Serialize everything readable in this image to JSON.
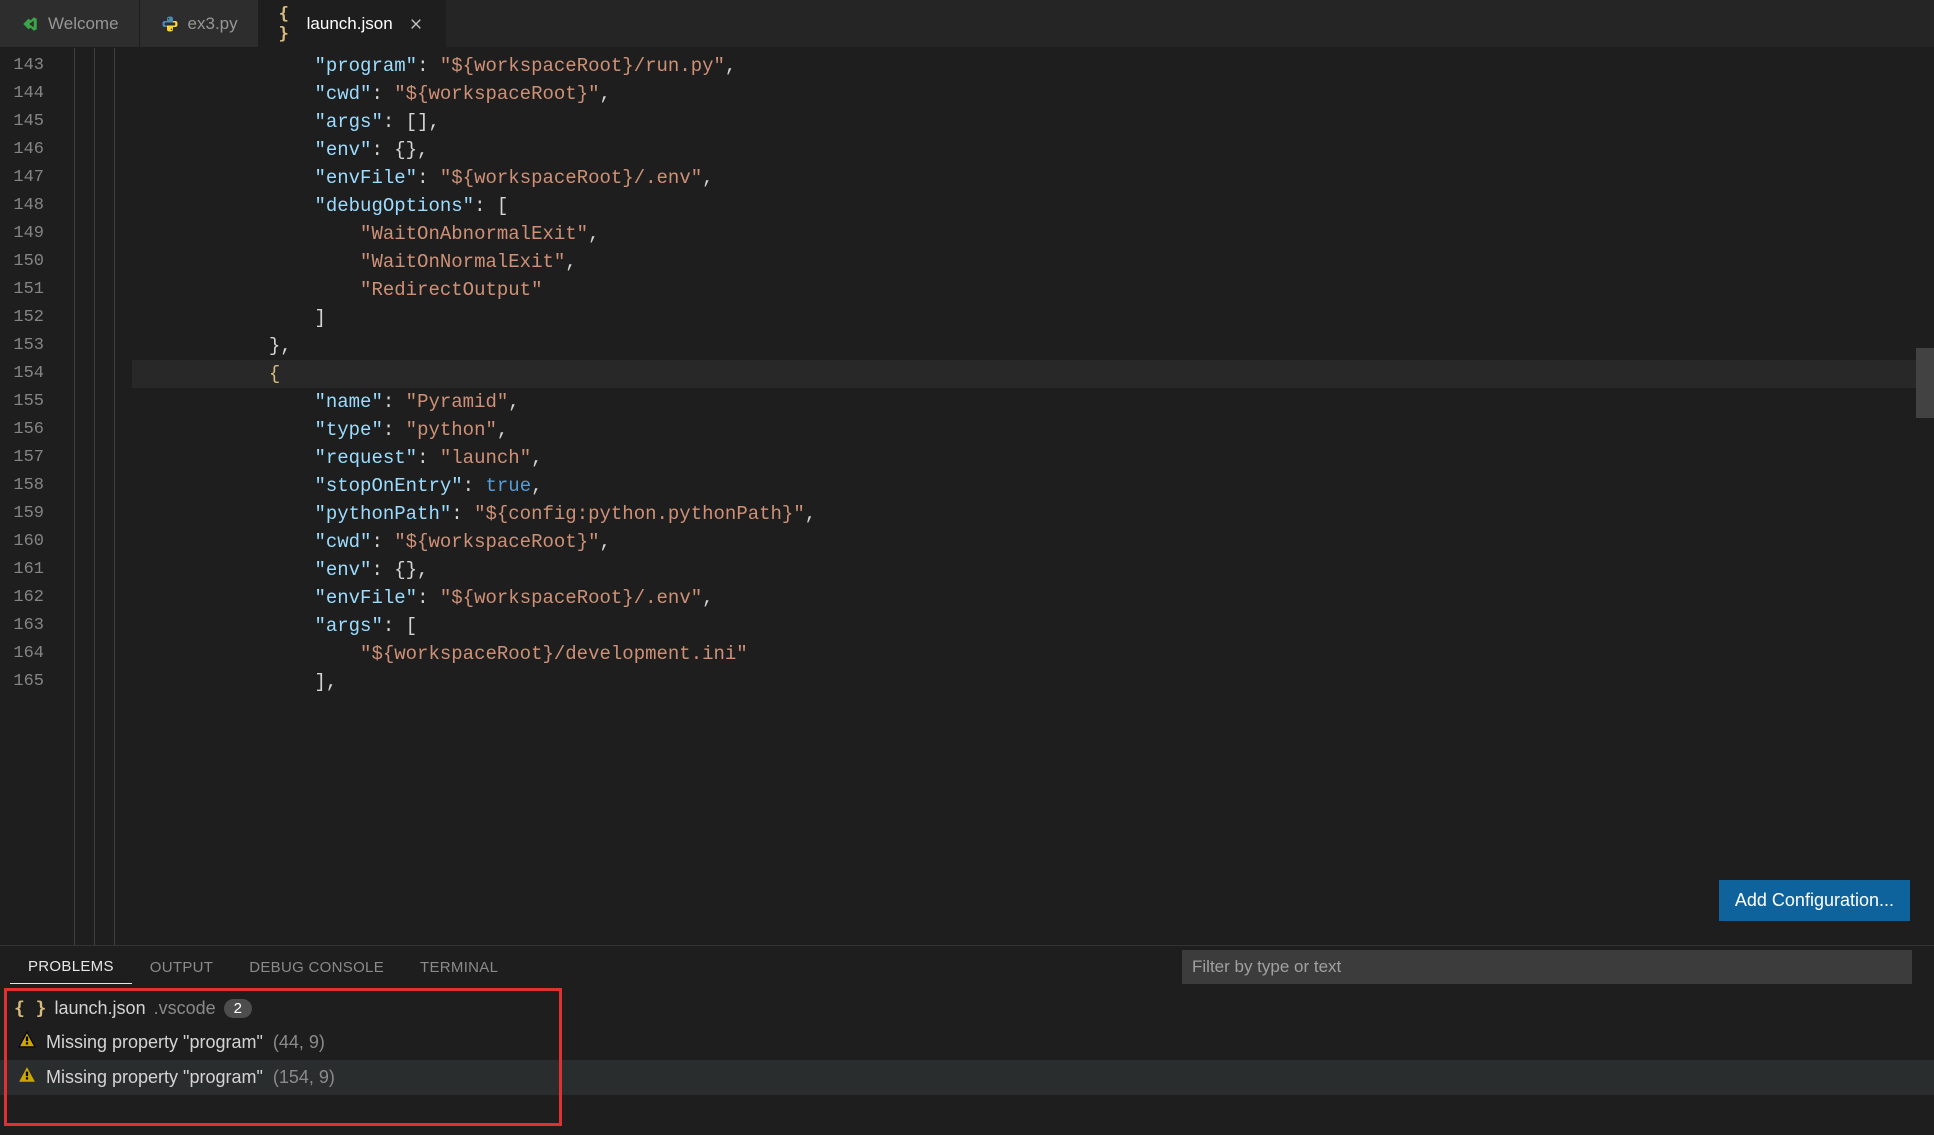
{
  "tabs": [
    {
      "label": "Welcome",
      "iconType": "vscode"
    },
    {
      "label": "ex3.py",
      "iconType": "python"
    },
    {
      "label": "launch.json",
      "iconType": "json",
      "active": true,
      "closeable": true
    }
  ],
  "editor": {
    "startLine": 143,
    "currentLine": 154,
    "lines": [
      {
        "n": 143,
        "indent": 16,
        "tokens": [
          {
            "t": "k",
            "v": "\"program\""
          },
          {
            "t": "p",
            "v": ": "
          },
          {
            "t": "s",
            "v": "\"${workspaceRoot}/run.py\""
          },
          {
            "t": "p",
            "v": ","
          }
        ]
      },
      {
        "n": 144,
        "indent": 16,
        "tokens": [
          {
            "t": "k",
            "v": "\"cwd\""
          },
          {
            "t": "p",
            "v": ": "
          },
          {
            "t": "s",
            "v": "\"${workspaceRoot}\""
          },
          {
            "t": "p",
            "v": ","
          }
        ]
      },
      {
        "n": 145,
        "indent": 16,
        "tokens": [
          {
            "t": "k",
            "v": "\"args\""
          },
          {
            "t": "p",
            "v": ": [],"
          }
        ]
      },
      {
        "n": 146,
        "indent": 16,
        "tokens": [
          {
            "t": "k",
            "v": "\"env\""
          },
          {
            "t": "p",
            "v": ": {},"
          }
        ]
      },
      {
        "n": 147,
        "indent": 16,
        "tokens": [
          {
            "t": "k",
            "v": "\"envFile\""
          },
          {
            "t": "p",
            "v": ": "
          },
          {
            "t": "s",
            "v": "\"${workspaceRoot}/.env\""
          },
          {
            "t": "p",
            "v": ","
          }
        ]
      },
      {
        "n": 148,
        "indent": 16,
        "tokens": [
          {
            "t": "k",
            "v": "\"debugOptions\""
          },
          {
            "t": "p",
            "v": ": ["
          }
        ]
      },
      {
        "n": 149,
        "indent": 20,
        "tokens": [
          {
            "t": "s",
            "v": "\"WaitOnAbnormalExit\""
          },
          {
            "t": "p",
            "v": ","
          }
        ]
      },
      {
        "n": 150,
        "indent": 20,
        "tokens": [
          {
            "t": "s",
            "v": "\"WaitOnNormalExit\""
          },
          {
            "t": "p",
            "v": ","
          }
        ]
      },
      {
        "n": 151,
        "indent": 20,
        "tokens": [
          {
            "t": "s",
            "v": "\"RedirectOutput\""
          }
        ]
      },
      {
        "n": 152,
        "indent": 16,
        "tokens": [
          {
            "t": "p",
            "v": "]"
          }
        ]
      },
      {
        "n": 153,
        "indent": 12,
        "tokens": [
          {
            "t": "p",
            "v": "},"
          }
        ]
      },
      {
        "n": 154,
        "indent": 12,
        "tokens": [
          {
            "t": "c",
            "v": "{"
          }
        ]
      },
      {
        "n": 155,
        "indent": 16,
        "tokens": [
          {
            "t": "k",
            "v": "\"name\""
          },
          {
            "t": "p",
            "v": ": "
          },
          {
            "t": "s",
            "v": "\"Pyramid\""
          },
          {
            "t": "p",
            "v": ","
          }
        ]
      },
      {
        "n": 156,
        "indent": 16,
        "tokens": [
          {
            "t": "k",
            "v": "\"type\""
          },
          {
            "t": "p",
            "v": ": "
          },
          {
            "t": "s",
            "v": "\"python\""
          },
          {
            "t": "p",
            "v": ","
          }
        ]
      },
      {
        "n": 157,
        "indent": 16,
        "tokens": [
          {
            "t": "k",
            "v": "\"request\""
          },
          {
            "t": "p",
            "v": ": "
          },
          {
            "t": "s",
            "v": "\"launch\""
          },
          {
            "t": "p",
            "v": ","
          }
        ]
      },
      {
        "n": 158,
        "indent": 16,
        "tokens": [
          {
            "t": "k",
            "v": "\"stopOnEntry\""
          },
          {
            "t": "p",
            "v": ": "
          },
          {
            "t": "b",
            "v": "true"
          },
          {
            "t": "p",
            "v": ","
          }
        ]
      },
      {
        "n": 159,
        "indent": 16,
        "tokens": [
          {
            "t": "k",
            "v": "\"pythonPath\""
          },
          {
            "t": "p",
            "v": ": "
          },
          {
            "t": "s",
            "v": "\"${config:python.pythonPath}\""
          },
          {
            "t": "p",
            "v": ","
          }
        ]
      },
      {
        "n": 160,
        "indent": 16,
        "tokens": [
          {
            "t": "k",
            "v": "\"cwd\""
          },
          {
            "t": "p",
            "v": ": "
          },
          {
            "t": "s",
            "v": "\"${workspaceRoot}\""
          },
          {
            "t": "p",
            "v": ","
          }
        ]
      },
      {
        "n": 161,
        "indent": 16,
        "tokens": [
          {
            "t": "k",
            "v": "\"env\""
          },
          {
            "t": "p",
            "v": ": {},"
          }
        ]
      },
      {
        "n": 162,
        "indent": 16,
        "tokens": [
          {
            "t": "k",
            "v": "\"envFile\""
          },
          {
            "t": "p",
            "v": ": "
          },
          {
            "t": "s",
            "v": "\"${workspaceRoot}/.env\""
          },
          {
            "t": "p",
            "v": ","
          }
        ]
      },
      {
        "n": 163,
        "indent": 16,
        "tokens": [
          {
            "t": "k",
            "v": "\"args\""
          },
          {
            "t": "p",
            "v": ": ["
          }
        ]
      },
      {
        "n": 164,
        "indent": 20,
        "tokens": [
          {
            "t": "s",
            "v": "\"${workspaceRoot}/development.ini\""
          }
        ]
      },
      {
        "n": 165,
        "indent": 16,
        "tokens": [
          {
            "t": "p",
            "v": "],"
          }
        ]
      }
    ],
    "button": "Add Configuration..."
  },
  "panel": {
    "tabs": [
      "PROBLEMS",
      "OUTPUT",
      "DEBUG CONSOLE",
      "TERMINAL"
    ],
    "activeTab": 0,
    "filterPlaceholder": "Filter by type or text",
    "group": {
      "file": "launch.json",
      "folder": ".vscode",
      "count": "2"
    },
    "items": [
      {
        "msg": "Missing property \"program\"",
        "loc": "(44, 9)"
      },
      {
        "msg": "Missing property \"program\"",
        "loc": "(154, 9)"
      }
    ]
  }
}
